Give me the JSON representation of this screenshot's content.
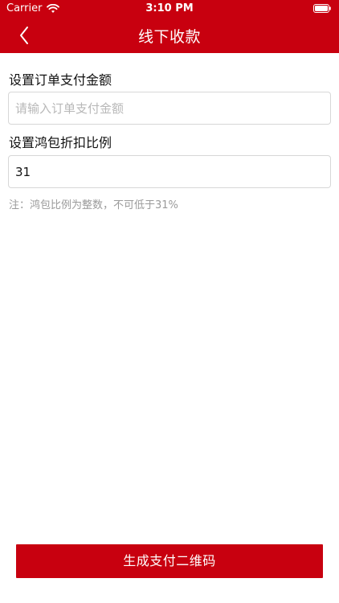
{
  "status_bar": {
    "carrier": "Carrier",
    "time": "3:10 PM",
    "wifi_icon": "wifi-icon",
    "battery_icon": "battery-icon"
  },
  "nav": {
    "title": "线下收款",
    "back_icon": "chevron-left-icon"
  },
  "form": {
    "amount_label": "设置订单支付金额",
    "amount_placeholder": "请输入订单支付金额",
    "amount_value": "",
    "ratio_label": "设置鸿包折扣比例",
    "ratio_value": "31",
    "note": "注：鸿包比例为整数，不可低于31%"
  },
  "actions": {
    "submit_label": "生成支付二维码"
  },
  "colors": {
    "brand": "#c8000f",
    "border": "#d7d7d7",
    "placeholder": "#b8b8b8",
    "note": "#9a9a9a"
  }
}
